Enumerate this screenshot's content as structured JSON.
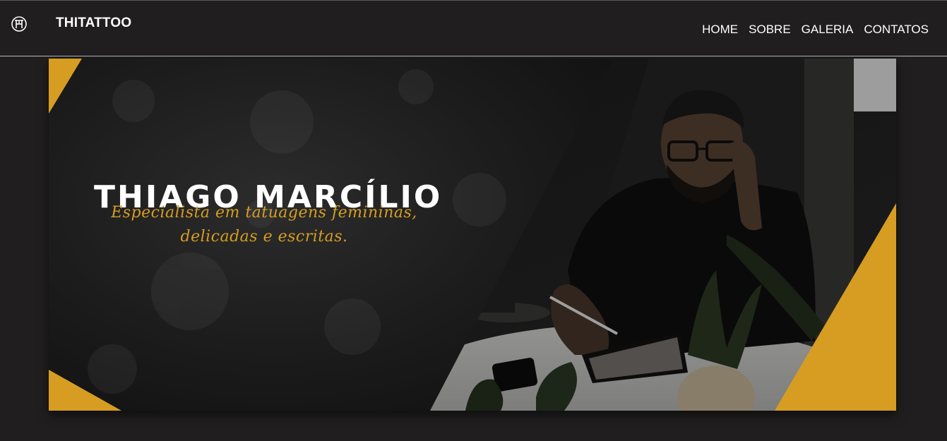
{
  "brand": {
    "name": "THITATTOO",
    "logo_icon": "th-monogram-icon"
  },
  "nav": {
    "items": [
      {
        "label": "HOME"
      },
      {
        "label": "SOBRE"
      },
      {
        "label": "GALERIA"
      },
      {
        "label": "CONTATOS"
      }
    ]
  },
  "hero": {
    "title": "THIAGO MARCÍLIO",
    "subtitle_line1": "Especialista em tatuagens femininas,",
    "subtitle_line2": "delicadas e escritas.",
    "photo": "tattoo-artist-photo"
  },
  "colors": {
    "background": "#201e1f",
    "accent": "#d69d22",
    "text": "#ffffff"
  }
}
